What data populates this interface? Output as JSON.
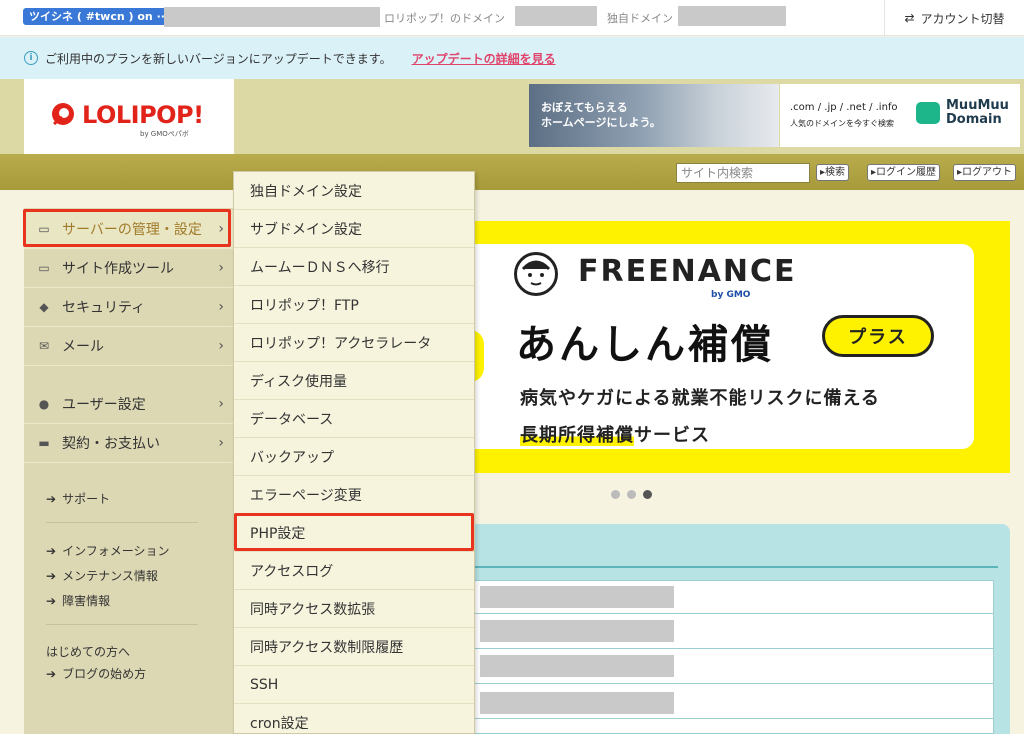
{
  "topbar": {
    "account_badge": "ツイシネ ( #twcn ) on ···",
    "domain_label": "ロリポップ！のドメイン",
    "own_domain_label": "独自ドメイン",
    "switch_account": "アカウント切替",
    "switch_icon": "swap-arrows-icon"
  },
  "notice": {
    "icon": "info-icon",
    "text": "ご利用中のプランを新しいバージョンにアップデートできます。",
    "link": "アップデートの詳細を見る",
    "link_color": "#e0446b"
  },
  "header": {
    "logo": "LOLIPOP!",
    "logo_sub": "by GMOペパボ",
    "ad1_text": [
      "おぼえてもらえる",
      "ホームページにしよう。"
    ],
    "ad2_tlds": ".com / .jp / .net / .info",
    "ad2_caption": "人気のドメインを今すぐ検索",
    "ad2_brand": [
      "MuuMuu",
      "Domain"
    ]
  },
  "toolbar": {
    "search_placeholder": "サイト内検索",
    "search_button": "▸検索",
    "login_history_button": "▸ログイン履歴",
    "logout_button": "▸ログアウト"
  },
  "sidebar": {
    "items": [
      {
        "label": "サーバーの管理・設定",
        "icon": "server-icon"
      },
      {
        "label": "サイト作成ツール",
        "icon": "laptop-icon"
      },
      {
        "label": "セキュリティ",
        "icon": "shield-icon"
      },
      {
        "label": "メール",
        "icon": "mail-icon"
      },
      {
        "label": "ユーザー設定",
        "icon": "user-icon"
      },
      {
        "label": "契約・お支払い",
        "icon": "card-icon"
      }
    ],
    "links": {
      "support": "サポート",
      "information": "インフォメーション",
      "maintenance": "メンテナンス情報",
      "outage": "障害情報",
      "first_time": "はじめての方へ",
      "blog_start": "ブログの始め方"
    }
  },
  "dropdown": {
    "items": [
      "独自ドメイン設定",
      "サブドメイン設定",
      "ムームーＤＮＳへ移行",
      "ロリポップ！FTP",
      "ロリポップ！アクセラレータ",
      "ディスク使用量",
      "データベース",
      "バックアップ",
      "エラーページ変更",
      "PHP設定",
      "アクセスログ",
      "同時アクセス数拡張",
      "同時アクセス数制限履歴",
      "SSH",
      "cron設定"
    ]
  },
  "banner": {
    "brand": "FREENANCE",
    "brand_by": "by GMO",
    "headline": "あんしん補償",
    "pill": "プラス",
    "line1": "病気やケガによる就業不能リスクに備える",
    "line2_highlight": "長期所得補償",
    "line2_rest": "サービス",
    "accent": "#fff200"
  },
  "colors": {
    "highlight_outline": "#e8331f",
    "olive": "#a69a3b",
    "sidebar_bg": "#ddd8b4"
  }
}
